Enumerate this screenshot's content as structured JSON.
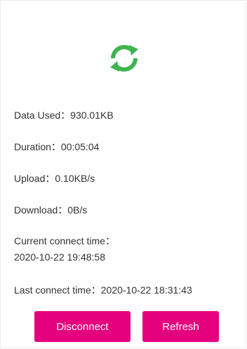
{
  "status": {
    "icon": "refresh-icon",
    "icon_color": "#3fb34f"
  },
  "stats": {
    "data_used_label": "Data Used",
    "data_used_value": "930.01KB",
    "duration_label": "Duration",
    "duration_value": "00:05:04",
    "upload_label": "Upload",
    "upload_value": "0.10KB/s",
    "download_label": "Download",
    "download_value": "0B/s",
    "current_connect_label": "Current connect time",
    "current_connect_value": "2020-10-22 19:48:58",
    "last_connect_label": "Last connect time",
    "last_connect_value": "2020-10-22 18:31:43",
    "separator": "："
  },
  "actions": {
    "disconnect_label": "Disconnect",
    "refresh_label": "Refresh",
    "accent_color": "#e5007e"
  }
}
